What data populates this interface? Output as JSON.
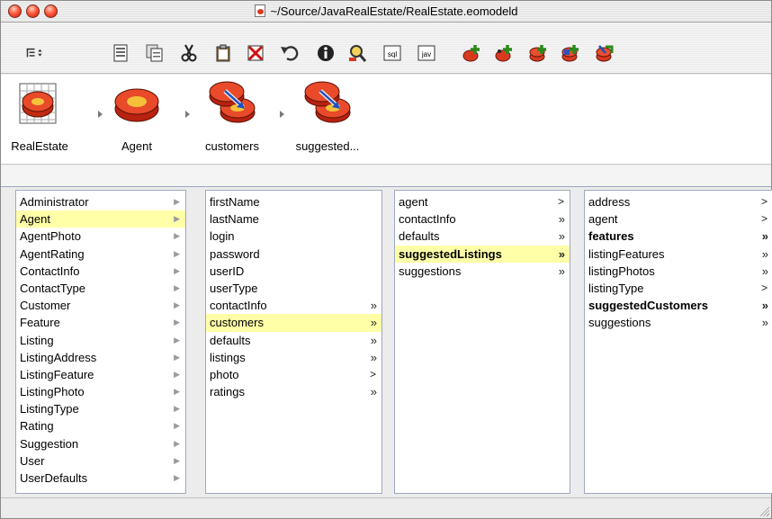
{
  "window": {
    "title": "~/Source/JavaRealEstate/RealEstate.eomodeld"
  },
  "toolbar": {
    "buttons": [
      {
        "name": "view-mode-popup",
        "icon": "list-popup-icon"
      },
      {
        "name": "new-entity",
        "icon": "new-document-icon"
      },
      {
        "name": "copy",
        "icon": "copy-icon"
      },
      {
        "name": "cut",
        "icon": "scissors-icon"
      },
      {
        "name": "paste",
        "icon": "clipboard-icon"
      },
      {
        "name": "delete",
        "icon": "delete-x-icon"
      },
      {
        "name": "undo",
        "icon": "undo-arrow-icon"
      },
      {
        "name": "inspector",
        "icon": "info-icon"
      },
      {
        "name": "data-browser",
        "icon": "magnifier-icon"
      },
      {
        "name": "generate-sql",
        "icon": "sql-icon",
        "label": "sql"
      },
      {
        "name": "generate-java",
        "icon": "java-icon",
        "label": "jav"
      },
      {
        "name": "add-attribute",
        "icon": "add-attribute-icon"
      },
      {
        "name": "add-relationship",
        "icon": "add-relationship-icon"
      },
      {
        "name": "add-fetch-spec",
        "icon": "add-fetchspec-icon"
      },
      {
        "name": "add-stored-procedure",
        "icon": "add-storedproc-icon"
      },
      {
        "name": "flatten",
        "icon": "flatten-icon"
      }
    ]
  },
  "path": [
    {
      "label": "RealEstate",
      "icon": "model-icon"
    },
    {
      "label": "Agent",
      "icon": "entity-icon"
    },
    {
      "label": "customers",
      "icon": "relationship-icon"
    },
    {
      "label": "suggested...",
      "icon": "relationship-icon"
    }
  ],
  "columns": [
    {
      "items": [
        {
          "label": "Administrator",
          "mark": "tri"
        },
        {
          "label": "Agent",
          "mark": "tri",
          "selected": true
        },
        {
          "label": "AgentPhoto",
          "mark": "tri"
        },
        {
          "label": "AgentRating",
          "mark": "tri"
        },
        {
          "label": "ContactInfo",
          "mark": "tri"
        },
        {
          "label": "ContactType",
          "mark": "tri"
        },
        {
          "label": "Customer",
          "mark": "tri"
        },
        {
          "label": "Feature",
          "mark": "tri"
        },
        {
          "label": "Listing",
          "mark": "tri"
        },
        {
          "label": "ListingAddress",
          "mark": "tri"
        },
        {
          "label": "ListingFeature",
          "mark": "tri"
        },
        {
          "label": "ListingPhoto",
          "mark": "tri"
        },
        {
          "label": "ListingType",
          "mark": "tri"
        },
        {
          "label": "Rating",
          "mark": "tri"
        },
        {
          "label": "Suggestion",
          "mark": "tri"
        },
        {
          "label": "User",
          "mark": "tri"
        },
        {
          "label": "UserDefaults",
          "mark": "tri"
        }
      ]
    },
    {
      "items": [
        {
          "label": "firstName",
          "mark": ""
        },
        {
          "label": "lastName",
          "mark": ""
        },
        {
          "label": "login",
          "mark": ""
        },
        {
          "label": "password",
          "mark": ""
        },
        {
          "label": "userID",
          "mark": ""
        },
        {
          "label": "userType",
          "mark": ""
        },
        {
          "label": "contactInfo",
          "mark": "dbl"
        },
        {
          "label": "customers",
          "mark": "dbl",
          "selected": true
        },
        {
          "label": "defaults",
          "mark": "dbl"
        },
        {
          "label": "listings",
          "mark": "dbl"
        },
        {
          "label": "photo",
          "mark": "sgl"
        },
        {
          "label": "ratings",
          "mark": "dbl"
        }
      ]
    },
    {
      "items": [
        {
          "label": "agent",
          "mark": "sgl"
        },
        {
          "label": "contactInfo",
          "mark": "dbl"
        },
        {
          "label": "defaults",
          "mark": "dbl"
        },
        {
          "label": "suggestedListings",
          "mark": "dbl",
          "selected": true,
          "bold": true
        },
        {
          "label": "suggestions",
          "mark": "dbl"
        }
      ]
    },
    {
      "items": [
        {
          "label": "address",
          "mark": "sgl"
        },
        {
          "label": "agent",
          "mark": "sgl"
        },
        {
          "label": "features",
          "mark": "dbl",
          "bold": true
        },
        {
          "label": "listingFeatures",
          "mark": "dbl"
        },
        {
          "label": "listingPhotos",
          "mark": "dbl"
        },
        {
          "label": "listingType",
          "mark": "sgl"
        },
        {
          "label": "suggestedCustomers",
          "mark": "dbl",
          "bold": true
        },
        {
          "label": "suggestions",
          "mark": "dbl"
        }
      ]
    }
  ],
  "marks": {
    "tri": "▶",
    "dbl": "»",
    "sgl": ">"
  },
  "colors": {
    "selection": "#ffffa8",
    "entity_red": "#d83a20",
    "add_green": "#3aa82a"
  }
}
